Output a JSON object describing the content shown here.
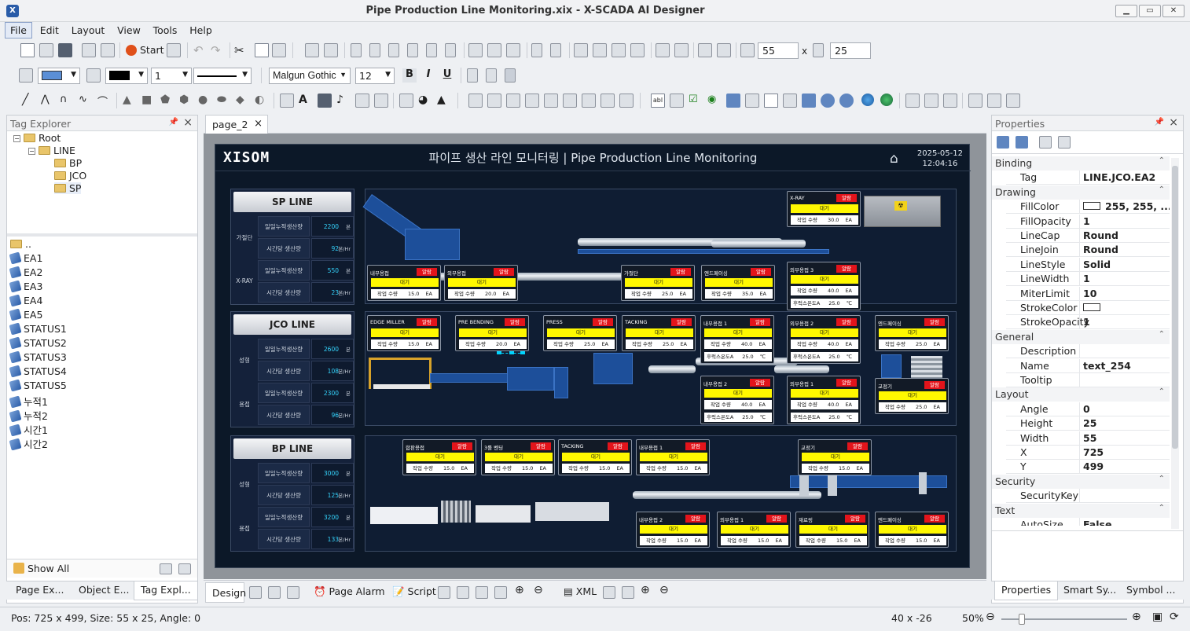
{
  "window": {
    "title": "Pipe Production Line Monitoring.xix - X-SCADA AI Designer"
  },
  "menu": [
    "File",
    "Edit",
    "Layout",
    "View",
    "Tools",
    "Help"
  ],
  "toolbar": {
    "start_label": "Start",
    "width_value": "55",
    "times": "x",
    "height_value": "25",
    "font_family": "Malgun Gothic",
    "font_size": "12",
    "line_width": "1",
    "bold": "B",
    "italic": "I",
    "underline": "U"
  },
  "tag_explorer": {
    "title": "Tag Explorer",
    "tree": [
      {
        "label": "Root",
        "level": 0,
        "expanded": true
      },
      {
        "label": "LINE",
        "level": 1,
        "expanded": true
      },
      {
        "label": "BP",
        "level": 2
      },
      {
        "label": "JCO",
        "level": 2
      },
      {
        "label": "SP",
        "level": 2
      }
    ],
    "tags": [
      "..",
      "EA1",
      "EA2",
      "EA3",
      "EA4",
      "EA5",
      "STATUS1",
      "STATUS2",
      "STATUS3",
      "STATUS4",
      "STATUS5",
      "누적1",
      "누적2",
      "시간1",
      "시간2"
    ],
    "show_all": "Show All",
    "bottom_tabs": [
      "Page Ex...",
      "Object E...",
      "Tag Expl..."
    ]
  },
  "document_tab": "page_2",
  "design_tabs": {
    "design": "Design",
    "page_alarm": "Page Alarm",
    "script": "Script",
    "xml": "XML"
  },
  "scada": {
    "logo": "XISOM",
    "title": "파이프 생산 라인 모니터링 | Pipe Production Line Monitoring",
    "date": "2025-05-12",
    "time": "12:04:16",
    "lines": [
      {
        "name": "SP LINE",
        "rows": [
          {
            "group": "가절단",
            "label": "일일누적생산량",
            "value": "2200",
            "unit": "본"
          },
          {
            "group": "",
            "label": "시간당 생산량",
            "value": "92",
            "unit": "본/Hr"
          },
          {
            "group": "X-RAY",
            "label": "일일누적생산량",
            "value": "550",
            "unit": "본"
          },
          {
            "group": "",
            "label": "시간당 생산량",
            "value": "23",
            "unit": "본/Hr"
          }
        ]
      },
      {
        "name": "JCO LINE",
        "rows": [
          {
            "group": "성형",
            "label": "일일누적생산량",
            "value": "2600",
            "unit": "본"
          },
          {
            "group": "",
            "label": "시간당 생산량",
            "value": "108",
            "unit": "본/Hr"
          },
          {
            "group": "용접",
            "label": "일일누적생산량",
            "value": "2300",
            "unit": "본"
          },
          {
            "group": "",
            "label": "시간당 생산량",
            "value": "96",
            "unit": "본/Hr"
          }
        ]
      },
      {
        "name": "BP LINE",
        "rows": [
          {
            "group": "성형",
            "label": "일일누적생산량",
            "value": "3000",
            "unit": "본"
          },
          {
            "group": "",
            "label": "시간당 생산량",
            "value": "125",
            "unit": "본/Hr"
          },
          {
            "group": "용접",
            "label": "일일누적생산량",
            "value": "3200",
            "unit": "본"
          },
          {
            "group": "",
            "label": "시간당 생산량",
            "value": "133",
            "unit": "본/Hr"
          }
        ]
      }
    ],
    "alarm": "알람",
    "wait": "대기",
    "qty_label": "작업 수량",
    "temp_label": "후럭스온도A",
    "stations": [
      {
        "name": "X-RAY",
        "qty": "30.0",
        "unit": "EA"
      },
      {
        "name": "내부용접",
        "qty": "15.0",
        "unit": "EA"
      },
      {
        "name": "외부용접",
        "qty": "20.0",
        "unit": "EA"
      },
      {
        "name": "가절단",
        "qty": "25.0",
        "unit": "EA"
      },
      {
        "name": "엔드페이싱",
        "qty": "35.0",
        "unit": "EA"
      },
      {
        "name": "외부용접 3",
        "qty": "40.0",
        "unit": "EA",
        "temp": "25.0",
        "tunit": "℃"
      },
      {
        "name": "EDGE MILLER",
        "qty": "15.0",
        "unit": "EA"
      },
      {
        "name": "PRE BENDING",
        "qty": "20.0",
        "unit": "EA"
      },
      {
        "name": "PRESS",
        "qty": "25.0",
        "unit": "EA"
      },
      {
        "name": "TACKING",
        "qty": "25.0",
        "unit": "EA"
      },
      {
        "name": "내부용접 1",
        "qty": "40.0",
        "unit": "EA",
        "temp": "25.0",
        "tunit": "℃"
      },
      {
        "name": "외부용접 2",
        "qty": "40.0",
        "unit": "EA",
        "temp": "25.0",
        "tunit": "℃"
      },
      {
        "name": "엔드페이싱",
        "qty": "25.0",
        "unit": "EA"
      },
      {
        "name": "내부용접 2",
        "qty": "40.0",
        "unit": "EA",
        "temp": "25.0",
        "tunit": "℃"
      },
      {
        "name": "외부용접 1",
        "qty": "40.0",
        "unit": "EA",
        "temp": "25.0",
        "tunit": "℃"
      },
      {
        "name": "교정기",
        "qty": "25.0",
        "unit": "EA"
      },
      {
        "name": "합판용접",
        "qty": "15.0",
        "unit": "EA"
      },
      {
        "name": "3롤 벤딩",
        "qty": "15.0",
        "unit": "EA"
      },
      {
        "name": "TACKING",
        "qty": "15.0",
        "unit": "EA"
      },
      {
        "name": "내부용접 1",
        "qty": "15.0",
        "unit": "EA"
      },
      {
        "name": "교정기",
        "qty": "15.0",
        "unit": "EA"
      },
      {
        "name": "내부용접 2",
        "qty": "15.0",
        "unit": "EA"
      },
      {
        "name": "외부용접 1",
        "qty": "15.0",
        "unit": "EA"
      },
      {
        "name": "재료링",
        "qty": "15.0",
        "unit": "EA"
      },
      {
        "name": "엔드페이싱",
        "qty": "15.0",
        "unit": "EA"
      }
    ]
  },
  "properties": {
    "title": "Properties",
    "categories": [
      {
        "name": "Binding",
        "rows": [
          {
            "k": "Tag",
            "v": "LINE.JCO.EA2"
          }
        ]
      },
      {
        "name": "Drawing",
        "rows": [
          {
            "k": "FillColor",
            "v": "255, 255, ..."
          },
          {
            "k": "FillOpacity",
            "v": "1"
          },
          {
            "k": "LineCap",
            "v": "Round"
          },
          {
            "k": "LineJoin",
            "v": "Round"
          },
          {
            "k": "LineStyle",
            "v": "Solid"
          },
          {
            "k": "LineWidth",
            "v": "1"
          },
          {
            "k": "MiterLimit",
            "v": "10"
          },
          {
            "k": "StrokeColor",
            "v": ""
          },
          {
            "k": "StrokeOpacity",
            "v": "1"
          }
        ]
      },
      {
        "name": "General",
        "rows": [
          {
            "k": "Description",
            "v": ""
          },
          {
            "k": "Name",
            "v": "text_254"
          },
          {
            "k": "Tooltip",
            "v": ""
          }
        ]
      },
      {
        "name": "Layout",
        "rows": [
          {
            "k": "Angle",
            "v": "0"
          },
          {
            "k": "Height",
            "v": "25"
          },
          {
            "k": "Width",
            "v": "55"
          },
          {
            "k": "X",
            "v": "725"
          },
          {
            "k": "Y",
            "v": "499"
          }
        ]
      },
      {
        "name": "Security",
        "rows": [
          {
            "k": "SecurityKey",
            "v": ""
          }
        ]
      },
      {
        "name": "Text",
        "rows": [
          {
            "k": "AutoSize",
            "v": "False"
          }
        ]
      }
    ],
    "bottom_tabs": [
      "Properties",
      "Smart Sy...",
      "Symbol ..."
    ]
  },
  "status": {
    "left": "Pos: 725 x 499, Size: 55 x 25, Angle: 0",
    "mid": "40 x -26",
    "zoom": "50%"
  }
}
